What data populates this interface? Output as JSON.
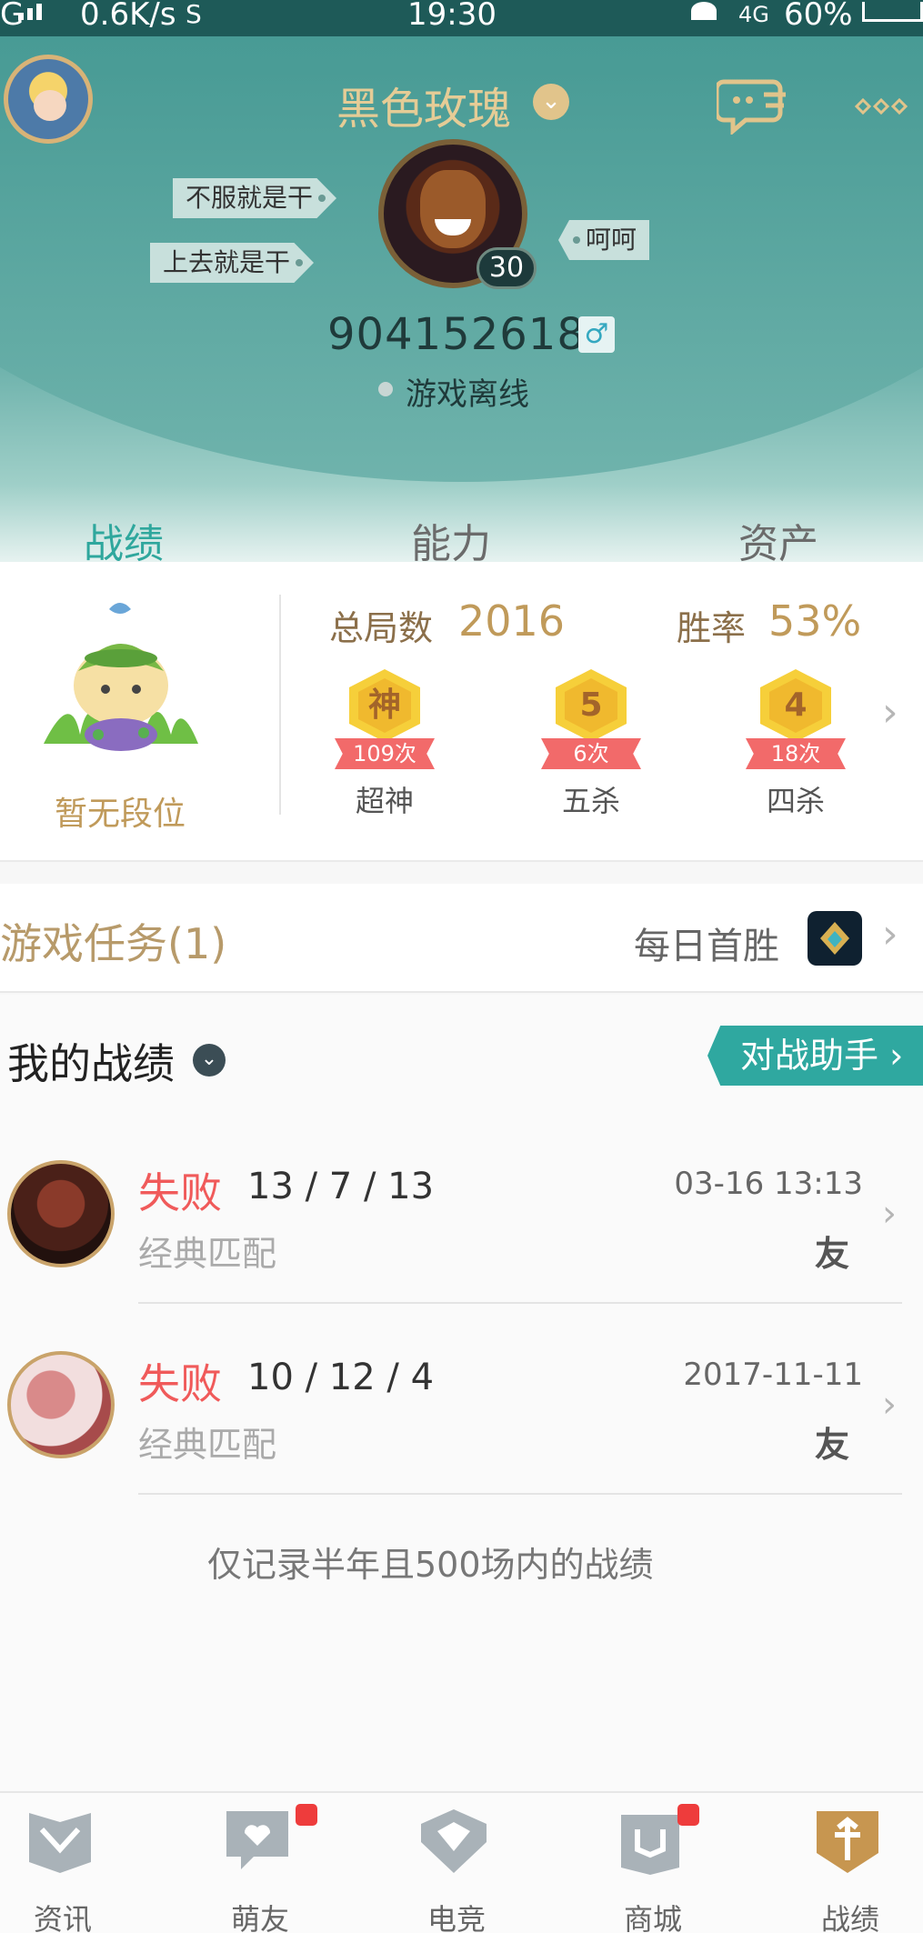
{
  "status_bar": {
    "signal": "G",
    "speed": "0.6K/s",
    "time": "19:30",
    "network": "4G",
    "battery": "60%"
  },
  "header": {
    "username": "黑色玫瑰",
    "player_id": "904152618",
    "gender_symbol": "♂",
    "status": "游戏离线",
    "level": "30",
    "tags_left": [
      "不服就是干",
      "上去就是干"
    ],
    "tag_right": "呵呵"
  },
  "tabs": [
    {
      "label": "战绩",
      "active": true
    },
    {
      "label": "能力",
      "active": false
    },
    {
      "label": "资产",
      "active": false
    }
  ],
  "stats": {
    "rank_label": "暂无段位",
    "total_games_label": "总局数",
    "total_games_value": "2016",
    "win_rate_label": "胜率",
    "win_rate_value": "53%",
    "medals": [
      {
        "glyph": "神",
        "count": "109次",
        "label": "超神"
      },
      {
        "glyph": "5",
        "count": "6次",
        "label": "五杀"
      },
      {
        "glyph": "4",
        "count": "18次",
        "label": "四杀"
      }
    ]
  },
  "quest": {
    "title": "游戏任务(1)",
    "right_label": "每日首胜"
  },
  "records": {
    "title": "我的战绩",
    "assistant_button": "对战助手 ›",
    "matches": [
      {
        "result": "失败",
        "kda": "13 / 7 / 13",
        "time": "03-16 13:13",
        "mode": "经典匹配",
        "friend": "友"
      },
      {
        "result": "失败",
        "kda": "10 / 12 / 4",
        "time": "2017-11-11",
        "mode": "经典匹配",
        "friend": "友"
      }
    ],
    "footnote": "仅记录半年且500场内的战绩"
  },
  "bottom_nav": [
    {
      "label": "资讯",
      "icon": "news-icon",
      "active": false,
      "badge": false
    },
    {
      "label": "萌友",
      "icon": "friends-icon",
      "active": false,
      "badge": true
    },
    {
      "label": "电竞",
      "icon": "esports-icon",
      "active": false,
      "badge": false
    },
    {
      "label": "商城",
      "icon": "store-icon",
      "active": false,
      "badge": true
    },
    {
      "label": "战绩",
      "icon": "record-icon",
      "active": true,
      "badge": false
    }
  ],
  "colors": {
    "accent": "#2fa79d",
    "gold": "#c09a5a",
    "loss": "#f05a5a",
    "badge": "#ee3c3c"
  }
}
